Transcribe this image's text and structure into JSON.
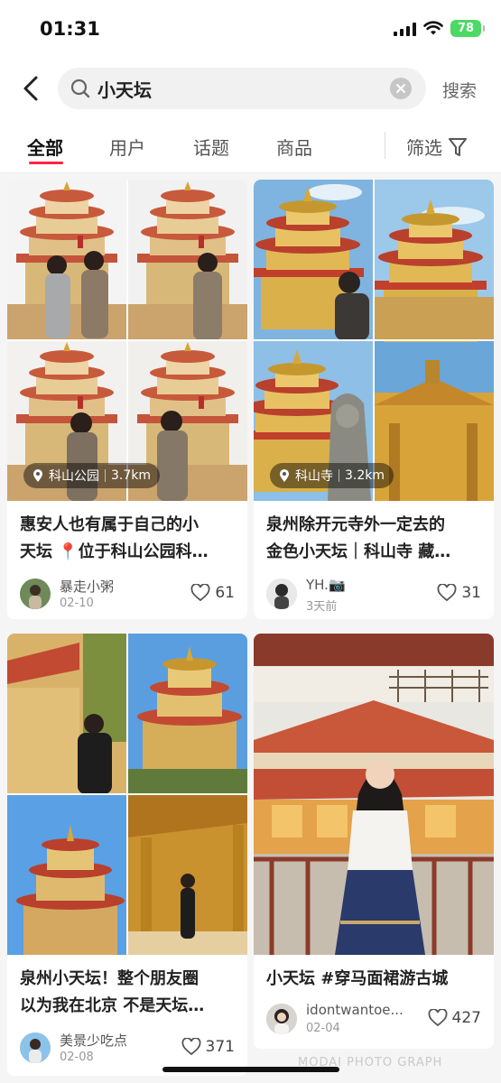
{
  "status_bar": {
    "time": "01:31",
    "battery": "78"
  },
  "search": {
    "query": "小天坛",
    "button_label": "搜索"
  },
  "tabs": [
    {
      "label": "全部",
      "active": true
    },
    {
      "label": "用户"
    },
    {
      "label": "话题"
    },
    {
      "label": "商品"
    }
  ],
  "filter": {
    "label": "筛选"
  },
  "feed": [
    {
      "location": "科山公园",
      "distance": "3.7km",
      "title_line1": "惠安人也有属于自己的小",
      "title_line2": "天坛 📍位于科山公园科…",
      "author": "暴走小粥",
      "date": "02-10",
      "likes": "61"
    },
    {
      "location": "科山寺",
      "distance": "3.2km",
      "title_line1": "泉州除开元寺外一定去的",
      "title_line2": "金色小天坛｜科山寺 藏…",
      "author": "YH.📷",
      "date": "3天前",
      "likes": "31"
    },
    {
      "title_line1": "泉州小天坛！整个朋友圈",
      "title_line2": "以为我在北京 不是天坛…",
      "author": "美景少吃点",
      "date": "02-08",
      "likes": "371"
    },
    {
      "title_line1": "小天坛 #穿马面裙游古城",
      "author": "idontwantoe...",
      "date": "02-04",
      "likes": "427"
    }
  ],
  "watermark": "MODAI PHOTO GRAPH",
  "colors": {
    "accent": "#ff2442",
    "battery": "#4cd964"
  }
}
